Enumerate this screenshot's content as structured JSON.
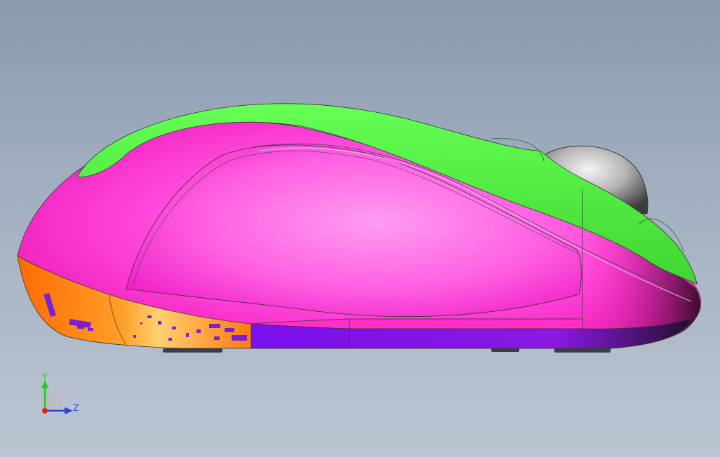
{
  "viewport": {
    "background_top": "#8a9aae",
    "background_bottom": "#bcc5d2"
  },
  "model": {
    "parts": [
      {
        "name": "top-shell",
        "color": "#55ee44"
      },
      {
        "name": "side-shell",
        "color": "#ff33cc"
      },
      {
        "name": "side-grip",
        "color": "#ff88ee"
      },
      {
        "name": "front-cover",
        "color": "#ff7a1a"
      },
      {
        "name": "base",
        "color": "#8811dd"
      },
      {
        "name": "scroll-wheel",
        "color": "#b8b8b8"
      }
    ]
  },
  "triad": {
    "y_label": "Y",
    "z_label": "Z",
    "y_color": "#22cc22",
    "z_color": "#2244dd",
    "x_color": "#dd2222"
  }
}
